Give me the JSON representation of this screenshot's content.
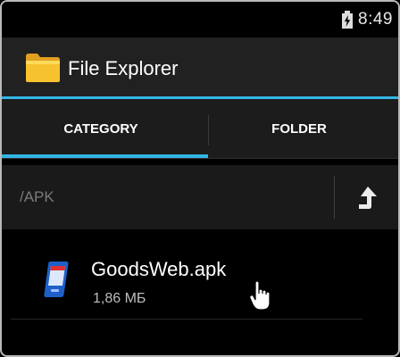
{
  "status_bar": {
    "time": "8:49"
  },
  "action_bar": {
    "title": "File Explorer",
    "icon": "folder-icon"
  },
  "tabs": [
    {
      "label": "CATEGORY",
      "selected": true
    },
    {
      "label": "FOLDER",
      "selected": false
    }
  ],
  "path_bar": {
    "path": "/APK",
    "up_icon": "up-arrow-icon"
  },
  "files": [
    {
      "name": "GoodsWeb.apk",
      "size": "1,86 МБ",
      "icon": "apk-phone-icon"
    }
  ],
  "colors": {
    "accent": "#33b5e5",
    "action_bar": "#212121",
    "background": "#000000"
  }
}
